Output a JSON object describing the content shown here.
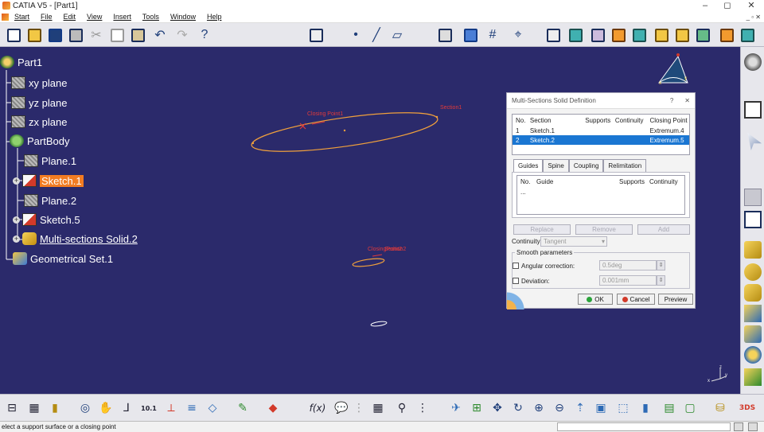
{
  "window": {
    "title": "CATIA V5 - [Part1]",
    "min": "–",
    "max": "◻",
    "close": "✕"
  },
  "menu": {
    "items": [
      "Start",
      "File",
      "Edit",
      "View",
      "Insert",
      "Tools",
      "Window",
      "Help"
    ],
    "mdi_controls": "_ ▫ ✕"
  },
  "tree": {
    "nodes": [
      {
        "label": "Part1",
        "icon": "part-icon"
      },
      {
        "label": "xy plane",
        "icon": "plane-icon"
      },
      {
        "label": "yz plane",
        "icon": "plane-icon"
      },
      {
        "label": "zx plane",
        "icon": "plane-icon"
      },
      {
        "label": "PartBody",
        "icon": "body-icon"
      },
      {
        "label": "Plane.1",
        "icon": "plane-icon"
      },
      {
        "label": "Sketch.1",
        "icon": "sketch-icon"
      },
      {
        "label": "Plane.2",
        "icon": "plane-icon"
      },
      {
        "label": "Sketch.5",
        "icon": "sketch-icon"
      },
      {
        "label": "Multi-sections Solid.2",
        "icon": "solid-icon"
      },
      {
        "label": "Geometrical Set.1",
        "icon": "geoset-icon"
      }
    ]
  },
  "viewport": {
    "labels": {
      "closing_point_1": "Closing Point1",
      "section_1": "Section1",
      "closing_point_2": "ClosingPoint2",
      "section_2": "Section2"
    },
    "compass_axes": {
      "x": "x",
      "y": "y"
    },
    "axis_triad": {
      "z": "z",
      "x": "x",
      "y": "y"
    }
  },
  "dialog": {
    "title": "Multi-Sections Solid Definition",
    "help": "?",
    "close": "✕",
    "sections_headers": [
      "No.",
      "Section",
      "Supports",
      "Continuity",
      "Closing Point"
    ],
    "sections_rows": [
      [
        "1",
        "Sketch.1",
        "",
        "",
        "Extremum.4"
      ],
      [
        "2",
        "Sketch.2",
        "",
        "",
        "Extremum.5"
      ]
    ],
    "tabs": [
      "Guides",
      "Spine",
      "Coupling",
      "Relimitation"
    ],
    "guides_headers": [
      "No.",
      "Guide",
      "Supports",
      "Continuity"
    ],
    "guides_rows": [
      [
        "...",
        "",
        "",
        ""
      ]
    ],
    "buttons": {
      "replace": "Replace",
      "remove": "Remove",
      "add": "Add"
    },
    "continuity": {
      "label": "Continuity:",
      "value": "Tangent"
    },
    "smooth": {
      "group": "Smooth parameters",
      "angular_label": "Angular correction:",
      "angular_value": "0.5deg",
      "deviation_label": "Deviation:",
      "deviation_value": "0.001mm"
    },
    "actions": {
      "ok": "OK",
      "cancel": "Cancel",
      "preview": "Preview"
    }
  },
  "status": {
    "message": "elect a support surface or a closing point"
  },
  "colors": {
    "background": "#2b2a6b",
    "selection": "#1a76d2",
    "highlight": "#f27c22",
    "curve": "#f0a03c",
    "label_red": "#e23a3a"
  }
}
